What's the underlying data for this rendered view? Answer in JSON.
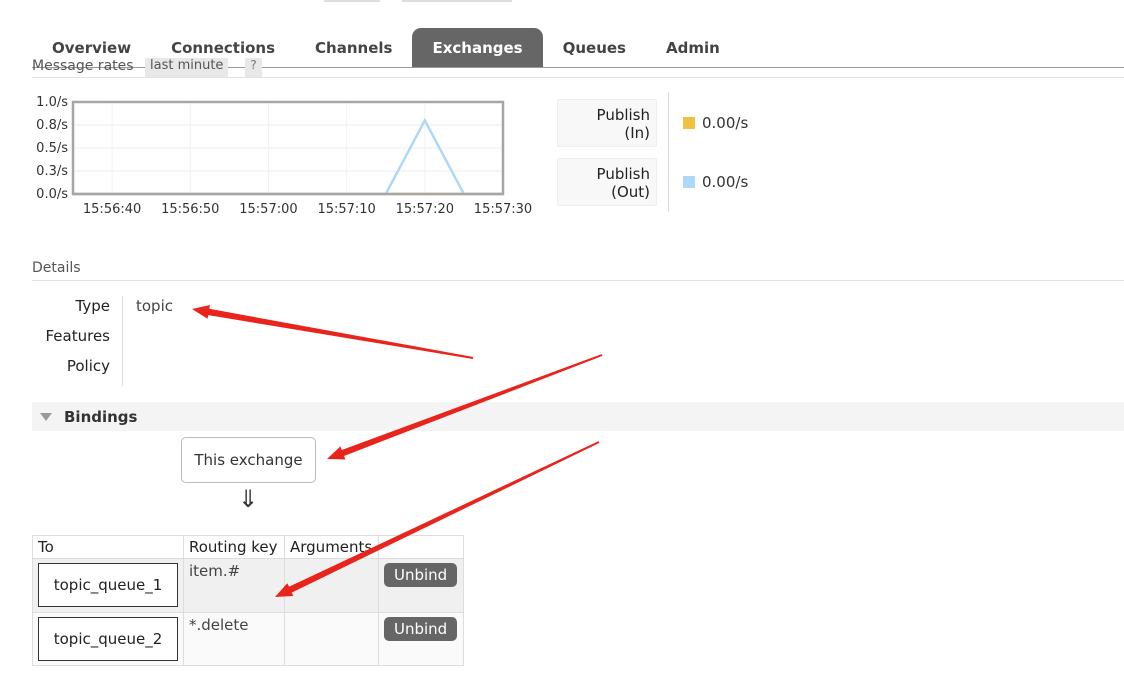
{
  "nav": {
    "tabs": [
      {
        "label": "Overview"
      },
      {
        "label": "Connections"
      },
      {
        "label": "Channels"
      },
      {
        "label": "Exchanges",
        "active": true
      },
      {
        "label": "Queues"
      },
      {
        "label": "Admin"
      }
    ]
  },
  "message_rates": {
    "label": "Message rates",
    "period": "last minute",
    "help": "?"
  },
  "chart_data": {
    "type": "line",
    "x": [
      "15:56:40",
      "15:56:50",
      "15:57:00",
      "15:57:10",
      "15:57:20",
      "15:57:30"
    ],
    "ytick_labels": [
      "1.0/s",
      "0.8/s",
      "0.5/s",
      "0.3/s",
      "0.0/s"
    ],
    "ylim": [
      0,
      1.0
    ],
    "xlim_seconds": [
      0,
      55
    ],
    "grid": true,
    "series": [
      {
        "name": "Publish (In)",
        "color": "#edc240",
        "points": [
          [
            0,
            0
          ],
          [
            55,
            0
          ]
        ]
      },
      {
        "name": "Publish (Out)",
        "color": "#afd8f8",
        "points": [
          [
            0,
            0
          ],
          [
            40,
            0
          ],
          [
            45,
            0.8
          ],
          [
            50,
            0
          ],
          [
            55,
            0
          ]
        ]
      }
    ]
  },
  "legend": [
    {
      "label": "Publish (In)",
      "line1": "Publish",
      "line2": "(In)",
      "value": "0.00/s",
      "color": "#edc240"
    },
    {
      "label": "Publish (Out)",
      "line1": "Publish",
      "line2": "(Out)",
      "value": "0.00/s",
      "color": "#afd8f8"
    }
  ],
  "details": {
    "title": "Details",
    "rows": [
      {
        "label": "Type",
        "value": "topic"
      },
      {
        "label": "Features",
        "value": ""
      },
      {
        "label": "Policy",
        "value": ""
      }
    ]
  },
  "bindings": {
    "title": "Bindings",
    "source": "This exchange",
    "arrow": "⇓",
    "columns": [
      "To",
      "Routing key",
      "Arguments"
    ],
    "rows": [
      {
        "to": "topic_queue_1",
        "routing_key": "item.#",
        "arguments": "",
        "action": "Unbind"
      },
      {
        "to": "topic_queue_2",
        "routing_key": "*.delete",
        "arguments": "",
        "action": "Unbind"
      }
    ]
  },
  "annotation_color": "#e8241c"
}
